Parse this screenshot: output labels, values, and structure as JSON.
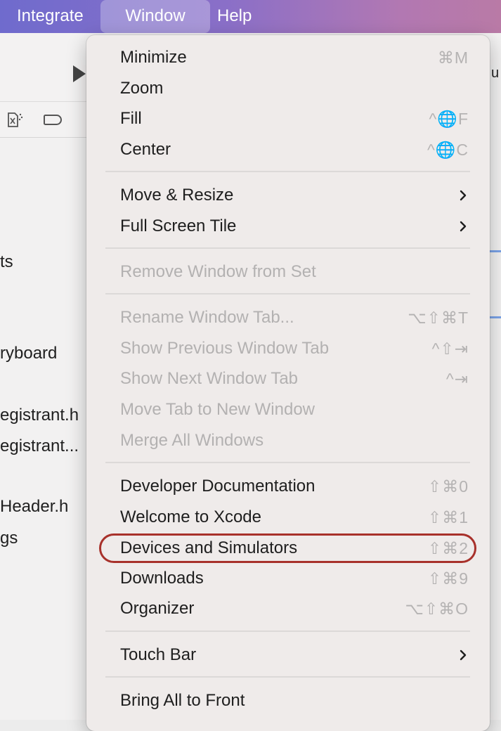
{
  "menubar": {
    "items": [
      "Integrate",
      "Window",
      "Help"
    ]
  },
  "background": {
    "files": [
      "ts",
      "ryboard",
      "egistrant.h",
      "egistrant...",
      "Header.h",
      "gs"
    ],
    "right_text": "u"
  },
  "menu": {
    "items": [
      {
        "label": "Minimize",
        "shortcut": "⌘M",
        "enabled": true
      },
      {
        "label": "Zoom",
        "shortcut": "",
        "enabled": true
      },
      {
        "label": "Fill",
        "shortcut": "^🌐F",
        "enabled": true
      },
      {
        "label": "Center",
        "shortcut": "^🌐C",
        "enabled": true
      },
      {
        "label": "Move & Resize",
        "submenu": true,
        "enabled": true
      },
      {
        "label": "Full Screen Tile",
        "submenu": true,
        "enabled": true
      },
      {
        "label": "Remove Window from Set",
        "shortcut": "",
        "enabled": false
      },
      {
        "label": "Rename Window Tab...",
        "shortcut": "⌥⇧⌘T",
        "enabled": false
      },
      {
        "label": "Show Previous Window Tab",
        "shortcut": "^⇧⇥",
        "enabled": false
      },
      {
        "label": "Show Next Window Tab",
        "shortcut": "^⇥",
        "enabled": false
      },
      {
        "label": "Move Tab to New Window",
        "shortcut": "",
        "enabled": false
      },
      {
        "label": "Merge All Windows",
        "shortcut": "",
        "enabled": false
      },
      {
        "label": "Developer Documentation",
        "shortcut": "⇧⌘0",
        "enabled": true
      },
      {
        "label": "Welcome to Xcode",
        "shortcut": "⇧⌘1",
        "enabled": true
      },
      {
        "label": "Devices and Simulators",
        "shortcut": "⇧⌘2",
        "enabled": true,
        "highlighted": true
      },
      {
        "label": "Downloads",
        "shortcut": "⇧⌘9",
        "enabled": true
      },
      {
        "label": "Organizer",
        "shortcut": "⌥⇧⌘O",
        "enabled": true
      },
      {
        "label": "Touch Bar",
        "submenu": true,
        "enabled": true
      },
      {
        "label": "Bring All to Front",
        "shortcut": "",
        "enabled": true
      }
    ]
  },
  "colors": {
    "highlight_ring": "#a8312b",
    "menu_background": "#efebea",
    "disabled_text": "#b3b1b1"
  }
}
